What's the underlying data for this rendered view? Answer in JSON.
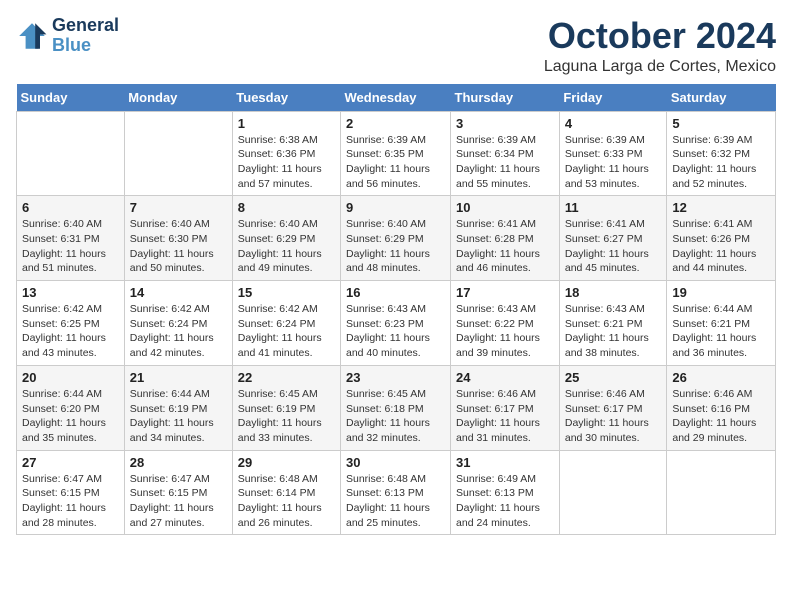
{
  "header": {
    "logo_line1": "General",
    "logo_line2": "Blue",
    "month": "October 2024",
    "location": "Laguna Larga de Cortes, Mexico"
  },
  "weekdays": [
    "Sunday",
    "Monday",
    "Tuesday",
    "Wednesday",
    "Thursday",
    "Friday",
    "Saturday"
  ],
  "weeks": [
    [
      {
        "day": "",
        "info": ""
      },
      {
        "day": "",
        "info": ""
      },
      {
        "day": "1",
        "info": "Sunrise: 6:38 AM\nSunset: 6:36 PM\nDaylight: 11 hours and 57 minutes."
      },
      {
        "day": "2",
        "info": "Sunrise: 6:39 AM\nSunset: 6:35 PM\nDaylight: 11 hours and 56 minutes."
      },
      {
        "day": "3",
        "info": "Sunrise: 6:39 AM\nSunset: 6:34 PM\nDaylight: 11 hours and 55 minutes."
      },
      {
        "day": "4",
        "info": "Sunrise: 6:39 AM\nSunset: 6:33 PM\nDaylight: 11 hours and 53 minutes."
      },
      {
        "day": "5",
        "info": "Sunrise: 6:39 AM\nSunset: 6:32 PM\nDaylight: 11 hours and 52 minutes."
      }
    ],
    [
      {
        "day": "6",
        "info": "Sunrise: 6:40 AM\nSunset: 6:31 PM\nDaylight: 11 hours and 51 minutes."
      },
      {
        "day": "7",
        "info": "Sunrise: 6:40 AM\nSunset: 6:30 PM\nDaylight: 11 hours and 50 minutes."
      },
      {
        "day": "8",
        "info": "Sunrise: 6:40 AM\nSunset: 6:29 PM\nDaylight: 11 hours and 49 minutes."
      },
      {
        "day": "9",
        "info": "Sunrise: 6:40 AM\nSunset: 6:29 PM\nDaylight: 11 hours and 48 minutes."
      },
      {
        "day": "10",
        "info": "Sunrise: 6:41 AM\nSunset: 6:28 PM\nDaylight: 11 hours and 46 minutes."
      },
      {
        "day": "11",
        "info": "Sunrise: 6:41 AM\nSunset: 6:27 PM\nDaylight: 11 hours and 45 minutes."
      },
      {
        "day": "12",
        "info": "Sunrise: 6:41 AM\nSunset: 6:26 PM\nDaylight: 11 hours and 44 minutes."
      }
    ],
    [
      {
        "day": "13",
        "info": "Sunrise: 6:42 AM\nSunset: 6:25 PM\nDaylight: 11 hours and 43 minutes."
      },
      {
        "day": "14",
        "info": "Sunrise: 6:42 AM\nSunset: 6:24 PM\nDaylight: 11 hours and 42 minutes."
      },
      {
        "day": "15",
        "info": "Sunrise: 6:42 AM\nSunset: 6:24 PM\nDaylight: 11 hours and 41 minutes."
      },
      {
        "day": "16",
        "info": "Sunrise: 6:43 AM\nSunset: 6:23 PM\nDaylight: 11 hours and 40 minutes."
      },
      {
        "day": "17",
        "info": "Sunrise: 6:43 AM\nSunset: 6:22 PM\nDaylight: 11 hours and 39 minutes."
      },
      {
        "day": "18",
        "info": "Sunrise: 6:43 AM\nSunset: 6:21 PM\nDaylight: 11 hours and 38 minutes."
      },
      {
        "day": "19",
        "info": "Sunrise: 6:44 AM\nSunset: 6:21 PM\nDaylight: 11 hours and 36 minutes."
      }
    ],
    [
      {
        "day": "20",
        "info": "Sunrise: 6:44 AM\nSunset: 6:20 PM\nDaylight: 11 hours and 35 minutes."
      },
      {
        "day": "21",
        "info": "Sunrise: 6:44 AM\nSunset: 6:19 PM\nDaylight: 11 hours and 34 minutes."
      },
      {
        "day": "22",
        "info": "Sunrise: 6:45 AM\nSunset: 6:19 PM\nDaylight: 11 hours and 33 minutes."
      },
      {
        "day": "23",
        "info": "Sunrise: 6:45 AM\nSunset: 6:18 PM\nDaylight: 11 hours and 32 minutes."
      },
      {
        "day": "24",
        "info": "Sunrise: 6:46 AM\nSunset: 6:17 PM\nDaylight: 11 hours and 31 minutes."
      },
      {
        "day": "25",
        "info": "Sunrise: 6:46 AM\nSunset: 6:17 PM\nDaylight: 11 hours and 30 minutes."
      },
      {
        "day": "26",
        "info": "Sunrise: 6:46 AM\nSunset: 6:16 PM\nDaylight: 11 hours and 29 minutes."
      }
    ],
    [
      {
        "day": "27",
        "info": "Sunrise: 6:47 AM\nSunset: 6:15 PM\nDaylight: 11 hours and 28 minutes."
      },
      {
        "day": "28",
        "info": "Sunrise: 6:47 AM\nSunset: 6:15 PM\nDaylight: 11 hours and 27 minutes."
      },
      {
        "day": "29",
        "info": "Sunrise: 6:48 AM\nSunset: 6:14 PM\nDaylight: 11 hours and 26 minutes."
      },
      {
        "day": "30",
        "info": "Sunrise: 6:48 AM\nSunset: 6:13 PM\nDaylight: 11 hours and 25 minutes."
      },
      {
        "day": "31",
        "info": "Sunrise: 6:49 AM\nSunset: 6:13 PM\nDaylight: 11 hours and 24 minutes."
      },
      {
        "day": "",
        "info": ""
      },
      {
        "day": "",
        "info": ""
      }
    ]
  ]
}
